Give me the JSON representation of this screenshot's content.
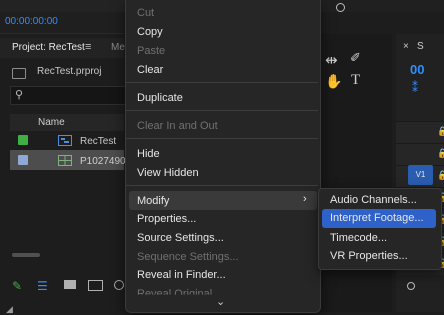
{
  "app": {
    "timecode": "00:00:00:00",
    "project_tab": "Project: RecTest",
    "menu_glyph": "≡",
    "media_tab_partial": "Me",
    "project_file": "RecTest.prproj",
    "columns": {
      "name": "Name"
    },
    "items": [
      {
        "label": "RecTest",
        "swatch_color": "#3fae44",
        "icon": "sequence-icon"
      },
      {
        "label": "P1027490.",
        "swatch_color": "#8fa9d6",
        "icon": "clip-icon",
        "selected": true
      }
    ],
    "right_panel": {
      "close": "×",
      "tab_partial": "S",
      "timecode": "00",
      "track_label": "V1"
    },
    "colors": {
      "accent": "#2f8fff",
      "selection": "#2e62c9",
      "label_green": "#3fae44"
    }
  },
  "context_menu": {
    "items": [
      {
        "label": "Cut",
        "enabled": false
      },
      {
        "label": "Copy",
        "enabled": true
      },
      {
        "label": "Paste",
        "enabled": false
      },
      {
        "label": "Clear",
        "enabled": true
      },
      {
        "label": "Duplicate",
        "enabled": true
      },
      {
        "label": "Clear In and Out",
        "enabled": false
      },
      {
        "label": "Hide",
        "enabled": true
      },
      {
        "label": "View Hidden",
        "enabled": true
      },
      {
        "label": "Modify",
        "enabled": true,
        "has_submenu": true,
        "hovered": true
      },
      {
        "label": "Properties...",
        "enabled": true
      },
      {
        "label": "Source Settings...",
        "enabled": true
      },
      {
        "label": "Sequence Settings...",
        "enabled": false
      },
      {
        "label": "Reveal in Finder...",
        "enabled": true
      },
      {
        "label": "Reveal Original",
        "enabled": false
      }
    ],
    "submenu_arrow": "›",
    "more_arrow": "⌄"
  },
  "submenu": {
    "items": [
      {
        "label": "Audio Channels..."
      },
      {
        "label": "Interpret Footage...",
        "highlighted": true
      },
      {
        "label": "Timecode..."
      },
      {
        "label": "VR Properties..."
      }
    ]
  }
}
